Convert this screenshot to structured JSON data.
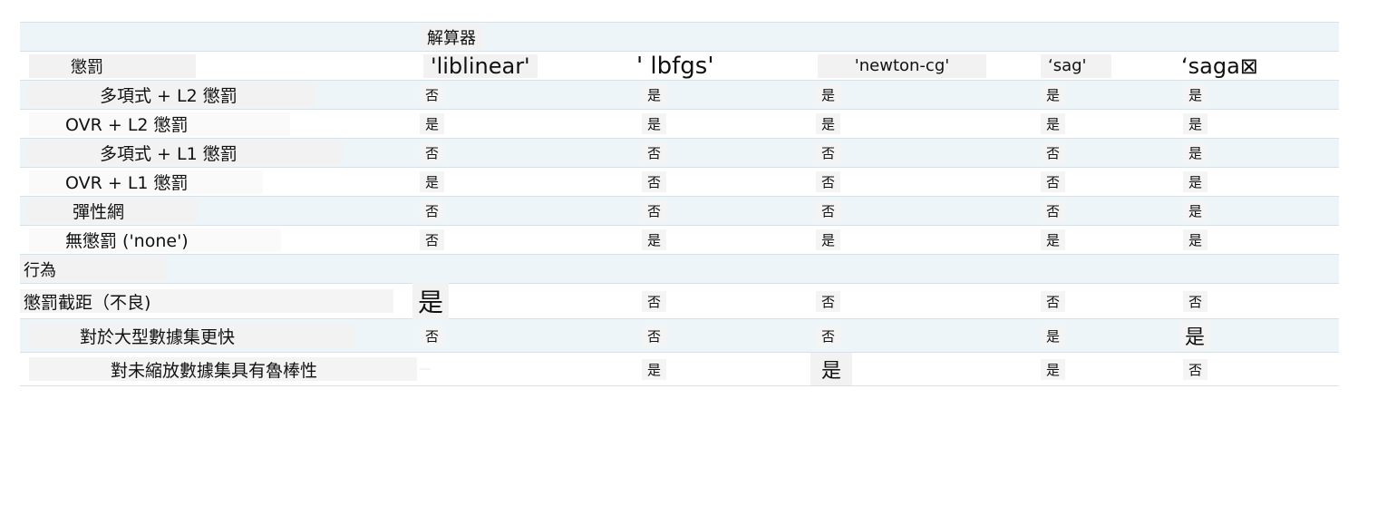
{
  "header": {
    "solver_title": "解算器",
    "penalty_label": "懲罰",
    "solvers": [
      "'liblinear'",
      "' lbfgs'",
      "'newton-cg'",
      "‘sag'",
      "‘saga⊠"
    ]
  },
  "rows_penalty": [
    {
      "label": "多項式 + L2 懲罰",
      "values": [
        "否",
        "是",
        "是",
        "是",
        "是"
      ]
    },
    {
      "label": "OVR + L2 懲罰",
      "values": [
        "是",
        "是",
        "是",
        "是",
        "是"
      ]
    },
    {
      "label": "多項式 + L1 懲罰",
      "values": [
        "否",
        "否",
        "否",
        "否",
        "是"
      ]
    },
    {
      "label": "OVR + L1 懲罰",
      "values": [
        "是",
        "否",
        "否",
        "否",
        "是"
      ]
    },
    {
      "label": "彈性網",
      "values": [
        "否",
        "否",
        "否",
        "否",
        "是"
      ]
    },
    {
      "label": "無懲罰 ('none')",
      "values": [
        "否",
        "是",
        "是",
        "是",
        "是"
      ]
    }
  ],
  "section_behavior": "行為",
  "rows_behavior": [
    {
      "label": "懲罰截距（不良)",
      "values": [
        "是",
        "否",
        "否",
        "否",
        "否"
      ]
    },
    {
      "label": "對於大型數據集更快",
      "values": [
        "否",
        "否",
        "否",
        "是",
        "是"
      ]
    },
    {
      "label": "對未縮放數據集具有魯棒性",
      "values": [
        "",
        "是",
        "是",
        "是",
        "否"
      ]
    }
  ]
}
